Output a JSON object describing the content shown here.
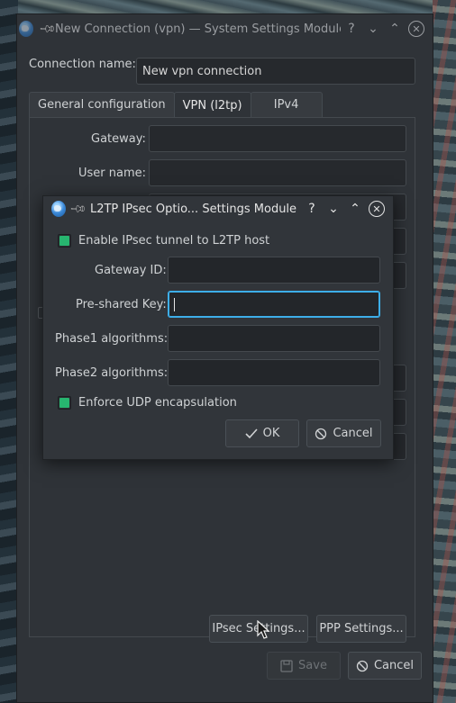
{
  "main": {
    "title": "New Connection (vpn) — System Settings Module",
    "connection_name_label": "Connection name:",
    "connection_name_value": "New vpn connection",
    "tabs": [
      {
        "label": "General configuration"
      },
      {
        "label": "VPN (l2tp)"
      },
      {
        "label": "IPv4"
      },
      {
        "label": ""
      }
    ],
    "gateway_label": "Gateway:",
    "gateway_value": "",
    "username_label": "User name:",
    "username_value": "",
    "ipsec_settings_label": "IPsec Settings...",
    "ppp_settings_label": "PPP Settings...",
    "save_label": "Save",
    "cancel_label": "Cancel"
  },
  "dialog": {
    "title": "L2TP IPsec Optio... Settings Module",
    "enable_ipsec_label": "Enable IPsec tunnel to L2TP host",
    "enable_ipsec_checked": true,
    "gateway_id_label": "Gateway ID:",
    "gateway_id_value": "",
    "psk_label": "Pre-shared Key:",
    "psk_value": "",
    "phase1_label": "Phase1 algorithms:",
    "phase1_value": "",
    "phase2_label": "Phase2 algorithms:",
    "phase2_value": "",
    "enforce_udp_label": "Enforce UDP encapsulation",
    "enforce_udp_checked": true,
    "ok_label": "OK",
    "cancel_label": "Cancel"
  },
  "colors": {
    "accent_focus": "#3daee9",
    "checkbox_green": "#27b56f",
    "window_bg": "#2f3338"
  },
  "icons": {
    "app": "globe-icon",
    "pin": "pin-icon",
    "help": "help-icon",
    "minimize": "chevron-down-icon",
    "maximize": "chevron-up-icon",
    "close": "close-icon"
  }
}
